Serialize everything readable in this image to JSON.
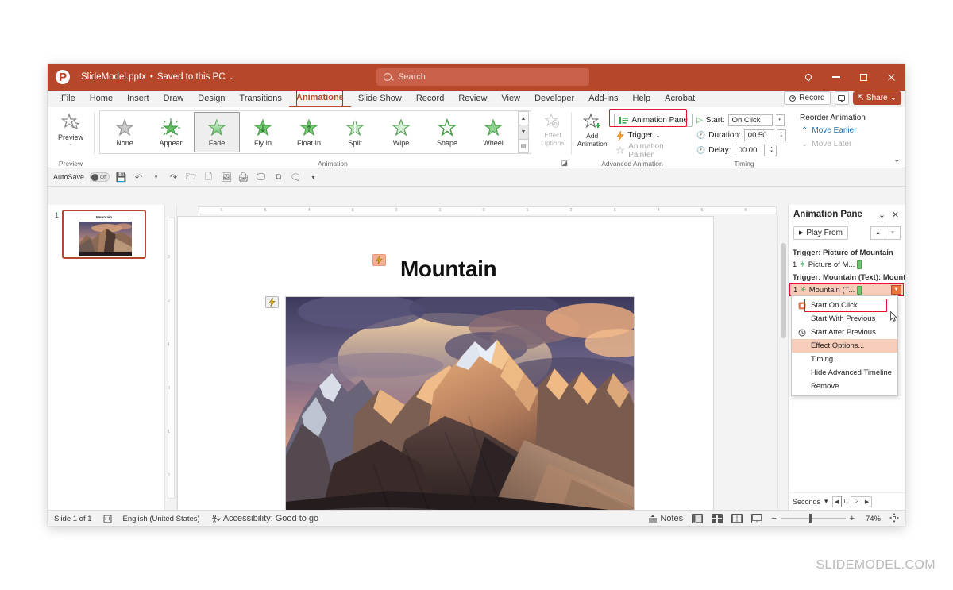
{
  "window": {
    "doc_title": "SlideModel.pptx",
    "save_state": "Saved to this PC",
    "separator": "•",
    "chevron": "⌄",
    "logo_glyph": "P"
  },
  "search": {
    "placeholder": "Search"
  },
  "window_controls": {
    "location": "location-pin",
    "minimize": "minimize",
    "maximize": "maximize",
    "close": "close"
  },
  "tabs": [
    {
      "label": "File",
      "active": false
    },
    {
      "label": "Home",
      "active": false
    },
    {
      "label": "Insert",
      "active": false
    },
    {
      "label": "Draw",
      "active": false
    },
    {
      "label": "Design",
      "active": false
    },
    {
      "label": "Transitions",
      "active": false
    },
    {
      "label": "Animations",
      "active": true
    },
    {
      "label": "Slide Show",
      "active": false
    },
    {
      "label": "Record",
      "active": false
    },
    {
      "label": "Review",
      "active": false
    },
    {
      "label": "View",
      "active": false
    },
    {
      "label": "Developer",
      "active": false
    },
    {
      "label": "Add-ins",
      "active": false
    },
    {
      "label": "Help",
      "active": false
    },
    {
      "label": "Acrobat",
      "active": false
    }
  ],
  "tab_right": {
    "record": "Record",
    "share": "Share",
    "share_chevron": "⌄"
  },
  "ribbon": {
    "preview": {
      "label": "Preview",
      "group": "Preview",
      "chevron": "⌄"
    },
    "animation": {
      "group": "Animation",
      "effects": [
        {
          "label": "None",
          "selected": false,
          "style": "gray"
        },
        {
          "label": "Appear",
          "selected": false,
          "style": "burst"
        },
        {
          "label": "Fade",
          "selected": true,
          "style": "fade"
        },
        {
          "label": "Fly In",
          "selected": false,
          "style": "green"
        },
        {
          "label": "Float In",
          "selected": false,
          "style": "green"
        },
        {
          "label": "Split",
          "selected": false,
          "style": "green"
        },
        {
          "label": "Wipe",
          "selected": false,
          "style": "green"
        },
        {
          "label": "Shape",
          "selected": false,
          "style": "green"
        },
        {
          "label": "Wheel",
          "selected": false,
          "style": "green"
        }
      ],
      "effect_options": "Effect Options",
      "effect_options_chevron": "⌄"
    },
    "advanced": {
      "group": "Advanced Animation",
      "add_animation": "Add Animation",
      "add_animation_chevron": "⌄",
      "animation_pane": "Animation Pane",
      "trigger": "Trigger",
      "trigger_chevron": "⌄",
      "animation_painter": "Animation Painter"
    },
    "timing": {
      "group": "Timing",
      "start_label": "Start:",
      "start_value": "On Click",
      "duration_label": "Duration:",
      "duration_value": "00.50",
      "delay_label": "Delay:",
      "delay_value": "00.00"
    },
    "reorder": {
      "heading": "Reorder Animation",
      "move_earlier": "Move Earlier",
      "move_later": "Move Later"
    }
  },
  "qat": {
    "autosave_label": "AutoSave",
    "autosave_state": "Off",
    "icons": [
      "save-icon",
      "undo-icon",
      "undo-chevron",
      "redo-icon",
      "open-icon",
      "new-icon",
      "picture-icon",
      "print-preview-icon",
      "slideshow-icon",
      "duplicate-icon",
      "comment-icon",
      "more-icon"
    ]
  },
  "thumbnails": {
    "slide_number": "1",
    "slide_title": "Mountain"
  },
  "rulers": {
    "horizontal": [
      "6",
      "5",
      "4",
      "3",
      "2",
      "1",
      "0",
      "1",
      "2",
      "3",
      "4",
      "5",
      "6"
    ],
    "vertical": [
      "3",
      "2",
      "1",
      "0",
      "1",
      "2",
      "3"
    ]
  },
  "slide": {
    "title": "Mountain",
    "title_trigger_badge": "⚡",
    "image_trigger_badge": "⚡",
    "image_alt": "Mountain sunset landscape"
  },
  "animation_pane": {
    "title": "Animation Pane",
    "collapse_icon": "⌄",
    "close_icon": "✕",
    "play_from": "Play From",
    "play_icon": "▶",
    "move_up_icon": "▲",
    "move_down_icon": "▼",
    "groups": [
      {
        "trigger": "Trigger: Picture of Mountain",
        "items": [
          {
            "index": "1",
            "label": "Picture of M...",
            "selected": false
          }
        ]
      },
      {
        "trigger": "Trigger: Mountain (Text): Mountain",
        "items": [
          {
            "index": "1",
            "label": "Mountain (T...",
            "selected": true
          }
        ]
      }
    ],
    "context_menu": [
      {
        "label": "Start On Click",
        "icon": "mouse-click-icon",
        "highlighted": false
      },
      {
        "label": "Start With Previous",
        "icon": "",
        "highlighted": false
      },
      {
        "label": "Start After Previous",
        "icon": "clock-icon",
        "highlighted": false
      },
      {
        "label": "Effect Options...",
        "icon": "",
        "highlighted": true
      },
      {
        "label": "Timing...",
        "icon": "",
        "highlighted": false
      },
      {
        "label": "Hide Advanced Timeline",
        "icon": "",
        "highlighted": false
      },
      {
        "label": "Remove",
        "icon": "",
        "highlighted": false
      }
    ],
    "footer": {
      "seconds_label": "Seconds",
      "seconds_chevron": "▾",
      "left_arrow": "◀",
      "value_0": "0",
      "value_2": "2",
      "right_arrow": "▶"
    }
  },
  "statusbar": {
    "slide_count": "Slide 1 of 1",
    "spellcheck_icon": "spellcheck-icon",
    "language": "English (United States)",
    "accessibility": "Accessibility: Good to go",
    "notes": "Notes",
    "views": [
      "normal-view-icon",
      "slide-sorter-icon",
      "reading-view-icon",
      "slideshow-view-icon"
    ],
    "zoom_minus": "−",
    "zoom_plus": "+",
    "zoom_percent": "74%",
    "fit_icon": "fit-to-window-icon"
  },
  "watermark": "SLIDEMODEL.COM",
  "colors": {
    "brand": "#b7472a",
    "highlight_red": "#e8112d",
    "green": "#3aa655",
    "selection_peach": "#f7cdba"
  }
}
